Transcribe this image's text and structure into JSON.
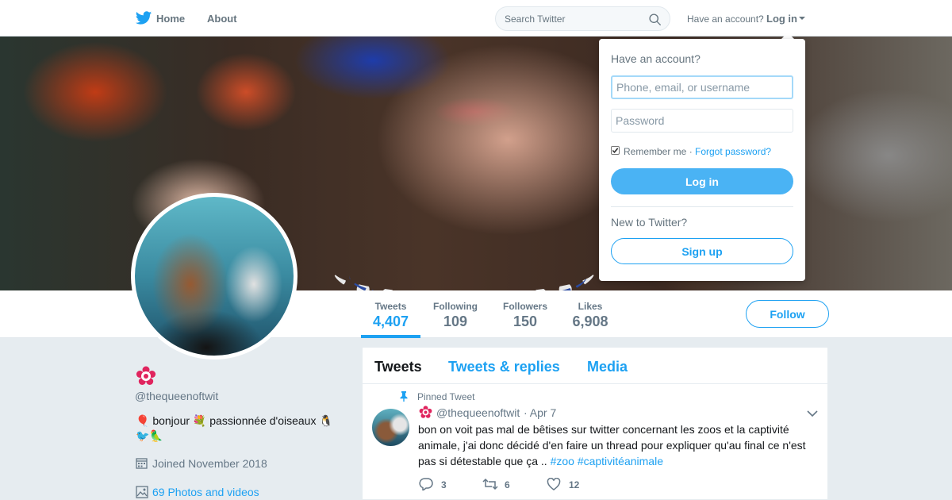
{
  "nav": {
    "home_label": "Home",
    "about_label": "About",
    "search_placeholder": "Search Twitter",
    "have_account": "Have an account?",
    "login_label": "Log in"
  },
  "profile": {
    "handle": "@thequeenoftwit",
    "bio_line1": "bonjour",
    "bio_mid": "passionnée d'oiseaux",
    "joined": "Joined November 2018",
    "photos": "69 Photos and videos",
    "follow_label": "Follow",
    "stats": [
      {
        "label": "Tweets",
        "value": "4,407"
      },
      {
        "label": "Following",
        "value": "109"
      },
      {
        "label": "Followers",
        "value": "150"
      },
      {
        "label": "Likes",
        "value": "6,908"
      }
    ]
  },
  "timeline": {
    "tabs": [
      "Tweets",
      "Tweets & replies",
      "Media"
    ],
    "pinned_label": "Pinned Tweet",
    "tweet": {
      "handle": "@thequeenoftwit",
      "date": "· Apr 7",
      "text": "bon on voit pas mal de bêtises sur twitter concernant les zoos et la captivité animale, j'ai donc décidé d'en faire un thread pour expliquer qu'au final ce n'est pas si détestable que ça ..",
      "tag1": "#zoo",
      "tag2": "#captivitéanimale",
      "replies": "3",
      "retweets": "6",
      "likes": "12"
    }
  },
  "login_dropdown": {
    "title": "Have an account?",
    "username_placeholder": "Phone, email, or username",
    "password_placeholder": "Password",
    "remember_label": "Remember me ·",
    "forgot_label": "Forgot password?",
    "login_button": "Log in",
    "new_label": "New to Twitter?",
    "signup_button": "Sign up"
  },
  "colors": {
    "accent": "#1da1f2",
    "login_button": "#4ab3f4",
    "background": "#e6ecf0",
    "muted_text": "#657786"
  },
  "icons": [
    "twitter-bird-icon",
    "search-icon",
    "caret-down-icon",
    "flower-badge-icon",
    "calendar-icon",
    "photo-icon",
    "pin-icon",
    "reply-icon",
    "retweet-icon",
    "heart-icon",
    "chevron-down-icon"
  ]
}
